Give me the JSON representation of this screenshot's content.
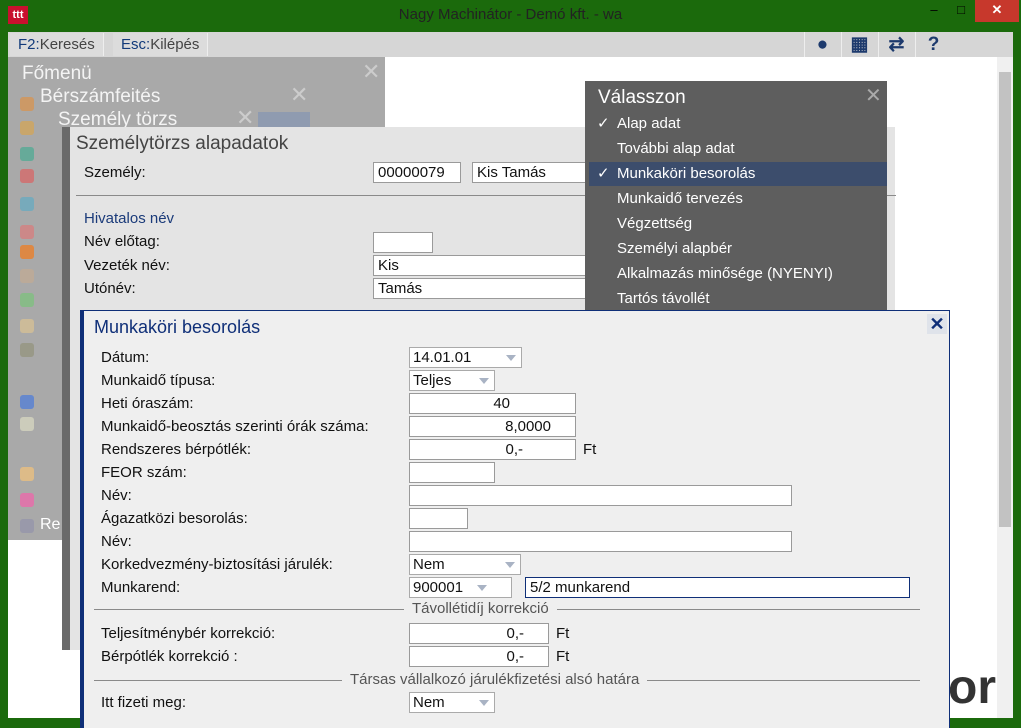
{
  "window": {
    "title": "Nagy Machinátor - Demó kft. - wa",
    "logo": "ttt",
    "minimize": "–",
    "maximize": "□",
    "close": "✕"
  },
  "toolbar": {
    "f2_key": "F2:",
    "f2_label": "Keresés",
    "esc_key": "Esc:",
    "esc_label": "Kilépés",
    "icons": [
      "user-icon",
      "grid-icon",
      "swap-icon",
      "help-icon"
    ],
    "help": "?"
  },
  "menu": {
    "title": "Főmenü",
    "sub1": "Bérszámfeités",
    "sub2": "Személy törzs",
    "bottom": "Re"
  },
  "szemelytorzs": {
    "title": "Személytörzs alapadatok",
    "szemely_label": "Személy:",
    "szemely_id": "00000079",
    "szemely_name": "Kis Tamás",
    "section": "Hivatalos név",
    "nev_elotag_label": "Név előtag:",
    "nev_elotag": "",
    "vezeteknev_label": "Vezeték név:",
    "vezeteknev": "Kis",
    "utonev_label": "Utónév:",
    "utonev": "Tamás"
  },
  "valasszon": {
    "title": "Válasszon",
    "items": [
      {
        "label": "Alap adat",
        "checked": true
      },
      {
        "label": "További alap adat",
        "checked": false
      },
      {
        "label": "Munkaköri besorolás",
        "checked": true
      },
      {
        "label": "Munkaidő tervezés",
        "checked": false
      },
      {
        "label": "Végzettség",
        "checked": false
      },
      {
        "label": "Személyi alapbér",
        "checked": false
      },
      {
        "label": "Alkalmazás minősége (NYENYI)",
        "checked": false
      },
      {
        "label": "Tartós távollét",
        "checked": false
      }
    ],
    "check": "✓"
  },
  "munkakori": {
    "title": "Munkaköri besorolás",
    "datum_label": "Dátum:",
    "datum": "14.01.01",
    "munkaido_tipusa_label": "Munkaidő típusa:",
    "munkaido_tipusa": "Teljes",
    "heti_label": "Heti óraszám:",
    "heti": "40",
    "beosztas_label": "Munkaidő-beosztás szerinti órák száma:",
    "beosztas": "8,0000",
    "potlek_label": "Rendszeres bérpótlék:",
    "potlek": "0,-",
    "ft": "Ft",
    "feor_label": "FEOR szám:",
    "feor": "",
    "nev1_label": "Név:",
    "nev1": "",
    "agazat_label": "Ágazatközi besorolás:",
    "agazat": "",
    "nev2_label": "Név:",
    "nev2": "",
    "korked_label": "Korkedvezmény-biztosítási járulék:",
    "korked": "Nem",
    "munkarend_label": "Munkarend:",
    "munkarend_code": "900001",
    "munkarend_name": "5/2 munkarend",
    "tavollet_section": "Távollétidíj korrekció",
    "teljesitmeny_label": "Teljesítménybér korrekció:",
    "teljesitmeny": "0,-",
    "berpotlek_label": "Bérpótlék korrekció :",
    "berpotlek": "0,-",
    "tarsas_section": "Társas vállalkozó járulékfizetési alsó határa",
    "itt_label": "Itt fizeti meg:",
    "itt": "Nem"
  },
  "background_text": "or"
}
